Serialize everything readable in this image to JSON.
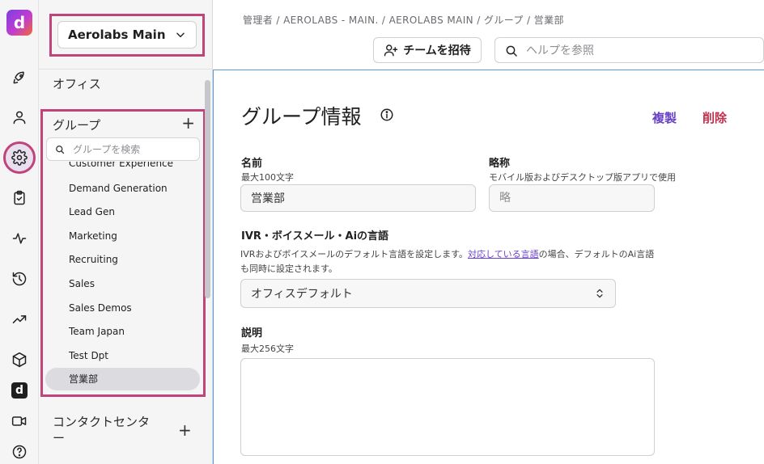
{
  "app": {
    "logo_letter": "d"
  },
  "rail": {
    "items": [
      "rocket-icon",
      "person-icon",
      "gear-icon",
      "clipboard-icon",
      "activity-icon",
      "history-icon",
      "trending-icon",
      "cube-icon",
      "dialpad-icon",
      "video-icon",
      "help-icon"
    ],
    "logo_letter": "d"
  },
  "sidebar": {
    "workspace": "Aerolabs Main",
    "office": "オフィス",
    "groups_title": "グループ",
    "add_symbol": "+",
    "group_search_placeholder": "グループを検索",
    "groups": [
      "Customer Experience",
      "Demand Generation",
      "Lead Gen",
      "Marketing",
      "Recruiting",
      "Sales",
      "Sales Demos",
      "Team Japan",
      "Test Dpt",
      "営業部"
    ],
    "active_group": "営業部",
    "contact_center_line1": "コンタクトセンタ",
    "contact_center_line2": "ー"
  },
  "header": {
    "breadcrumb": "管理者 / AEROLABS - MAIN. / AEROLABS MAIN / グループ / 営業部",
    "invite_label": "チームを招待",
    "help_placeholder": "ヘルプを参照"
  },
  "main": {
    "title": "グループ情報",
    "duplicate_label": "複製",
    "delete_label": "削除",
    "name_label": "名前",
    "name_hint": "最大100文字",
    "name_value": "営業部",
    "abbr_label": "略称",
    "abbr_hint": "モバイル版およびデスクトップ版アプリで使用",
    "abbr_placeholder": "略",
    "lang_label": "IVR・ボイスメール・Aiの言語",
    "lang_desc_part1": "IVRおよびボイスメールのデフォルト言語を設定します。",
    "lang_desc_link": "対応している言語",
    "lang_desc_part2": "の場合、デフォルトのAi言語も同時に設定されます。",
    "lang_value": "オフィスデフォルト",
    "desc_label": "説明",
    "desc_hint": "最大256文字"
  },
  "colors": {
    "highlight": "#c0447a",
    "link": "#6a42c8",
    "danger": "#c0304f"
  }
}
